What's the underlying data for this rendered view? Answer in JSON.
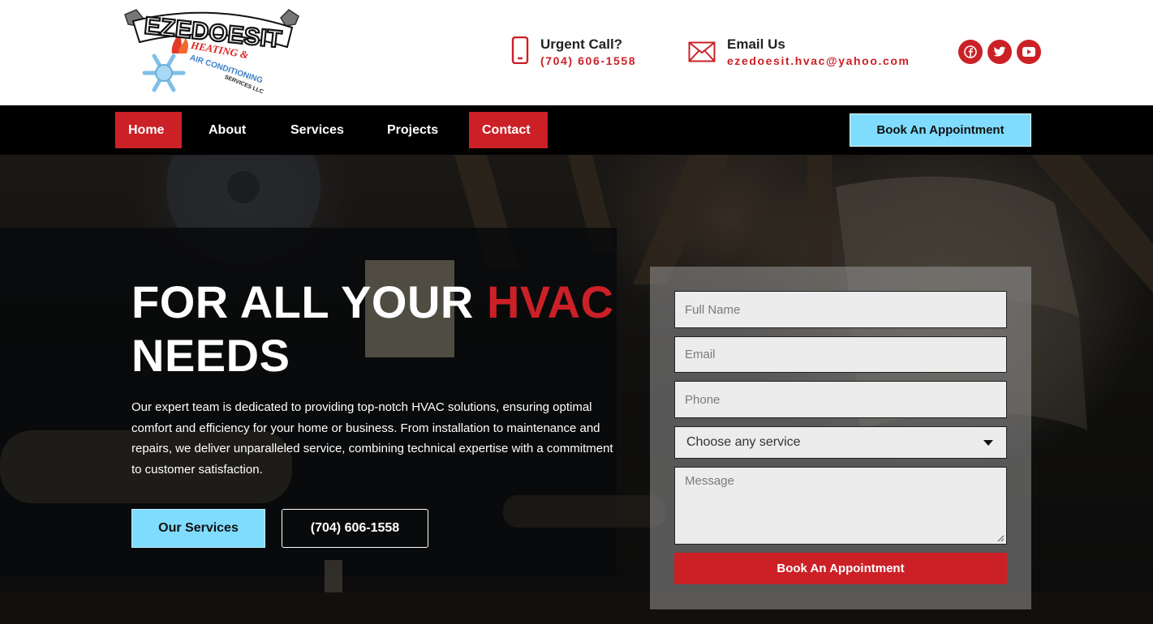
{
  "brand": {
    "logo_main": "EZEDOESIT",
    "logo_sub1": "HEATING &",
    "logo_sub2": "AIR CONDITIONING",
    "logo_sub3": "SERVICES LLC"
  },
  "header": {
    "urgent_title": "Urgent Call?",
    "urgent_phone": "(704) 606-1558",
    "email_title": "Email Us",
    "email_address": "ezedoesit.hvac@yahoo.com",
    "social": [
      "facebook-icon",
      "twitter-icon",
      "youtube-icon"
    ]
  },
  "nav": {
    "items": [
      {
        "label": "Home",
        "active": true
      },
      {
        "label": "About",
        "active": false
      },
      {
        "label": "Services",
        "active": false
      },
      {
        "label": "Projects",
        "active": false
      },
      {
        "label": "Contact",
        "active": true
      }
    ],
    "book_label": "Book An Appointment"
  },
  "hero": {
    "headline_part1": "FOR ALL YOUR ",
    "headline_accent": "HVAC",
    "headline_part2": "NEEDS",
    "description": "Our expert team is dedicated to providing top-notch HVAC solutions, ensuring optimal comfort and efficiency for your home or business. From installation to maintenance and repairs, we deliver unparalleled service, combining technical expertise with a commitment to customer satisfaction.",
    "services_button": "Our Services",
    "phone_button": "(704) 606-1558"
  },
  "form": {
    "full_name_placeholder": "Full Name",
    "email_placeholder": "Email",
    "phone_placeholder": "Phone",
    "service_selected": "Choose any service",
    "message_placeholder": "Message",
    "submit_label": "Book An Appointment"
  },
  "colors": {
    "accent_red": "#cc2027",
    "accent_blue": "#7fdcff",
    "nav_bg": "#000000"
  }
}
